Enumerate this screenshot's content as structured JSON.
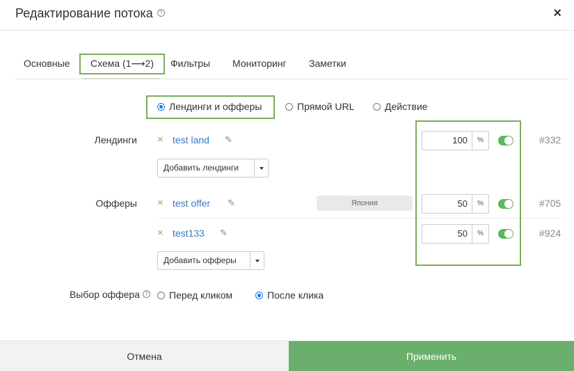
{
  "header": {
    "title": "Редактирование потока",
    "help_glyph": "?",
    "close_glyph": "×"
  },
  "tabs": [
    {
      "label": "Основные"
    },
    {
      "label": "Схема (1⟶2)"
    },
    {
      "label": "Фильтры"
    },
    {
      "label": "Мониторинг"
    },
    {
      "label": "Заметки"
    }
  ],
  "scheme": {
    "options": [
      {
        "label": "Лендинги и офферы",
        "selected": true
      },
      {
        "label": "Прямой URL",
        "selected": false
      },
      {
        "label": "Действие",
        "selected": false
      }
    ]
  },
  "landings": {
    "label": "Лендинги",
    "items": [
      {
        "name": "test land",
        "weight": "100",
        "unit": "%",
        "enabled": true,
        "id": "#332"
      }
    ],
    "add_button": "Добавить лендинги"
  },
  "offers": {
    "label": "Офферы",
    "items": [
      {
        "name": "test offer",
        "badge": "Япония",
        "weight": "50",
        "unit": "%",
        "enabled": true,
        "id": "#705"
      },
      {
        "name": "test133",
        "weight": "50",
        "unit": "%",
        "enabled": true,
        "id": "#924"
      }
    ],
    "add_button": "Добавить офферы"
  },
  "offer_selection": {
    "label": "Выбор оффера",
    "options": [
      {
        "label": "Перед кликом",
        "selected": false
      },
      {
        "label": "После клика",
        "selected": true
      }
    ]
  },
  "footer": {
    "cancel": "Отмена",
    "apply": "Применить"
  },
  "glyphs": {
    "remove": "×",
    "edit": "✎"
  },
  "colors": {
    "accent": "#6aaf6b",
    "link": "#3b7bbf",
    "highlight": "#7aac5a",
    "toggle_on": "#5cb85c"
  }
}
